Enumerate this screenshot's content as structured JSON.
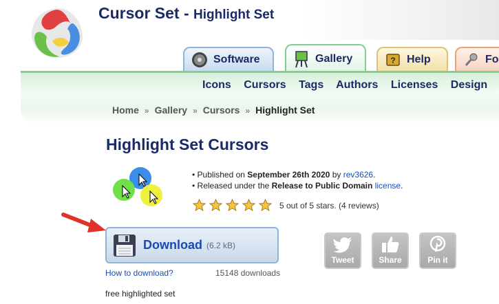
{
  "header": {
    "title": "Cursor Set",
    "separator": "-",
    "subtitle": "Highlight Set"
  },
  "tabs": [
    {
      "label": "Software",
      "icon": "disc-icon"
    },
    {
      "label": "Gallery",
      "icon": "easel-icon",
      "active": true
    },
    {
      "label": "Help",
      "icon": "help-book-icon"
    },
    {
      "label": "For",
      "icon": "microphone-icon"
    }
  ],
  "nav": {
    "links": [
      "Icons",
      "Cursors",
      "Tags",
      "Authors",
      "Licenses",
      "Design"
    ]
  },
  "breadcrumb": [
    "Home",
    "Gallery",
    "Cursors",
    "Highlight Set"
  ],
  "main": {
    "page_title": "Highlight Set Cursors",
    "published_prefix": "Published on",
    "published_date": "September 26th 2020",
    "published_by": "by",
    "author": "rev3626",
    "period": ".",
    "license_prefix": "Released under the",
    "license_name": "Release to Public Domain",
    "license_link": "license",
    "rating_value": 5,
    "rating_max": 5,
    "rating_text": "5 out of 5 stars. (4 reviews)"
  },
  "download": {
    "label": "Download",
    "size": "(6.2 kB)",
    "how_link": "How to download?",
    "count": "15148 downloads",
    "description": "free highlighted set"
  },
  "share": [
    {
      "label": "Tweet",
      "icon": "twitter-bird-icon"
    },
    {
      "label": "Share",
      "icon": "thumbs-up-icon"
    },
    {
      "label": "Pin it",
      "icon": "pinterest-icon"
    }
  ],
  "colors": {
    "title": "#1a2a66",
    "link": "#1a4ab4",
    "gallery_green": "#7fcf8f",
    "arrow_red": "#e0322b"
  }
}
